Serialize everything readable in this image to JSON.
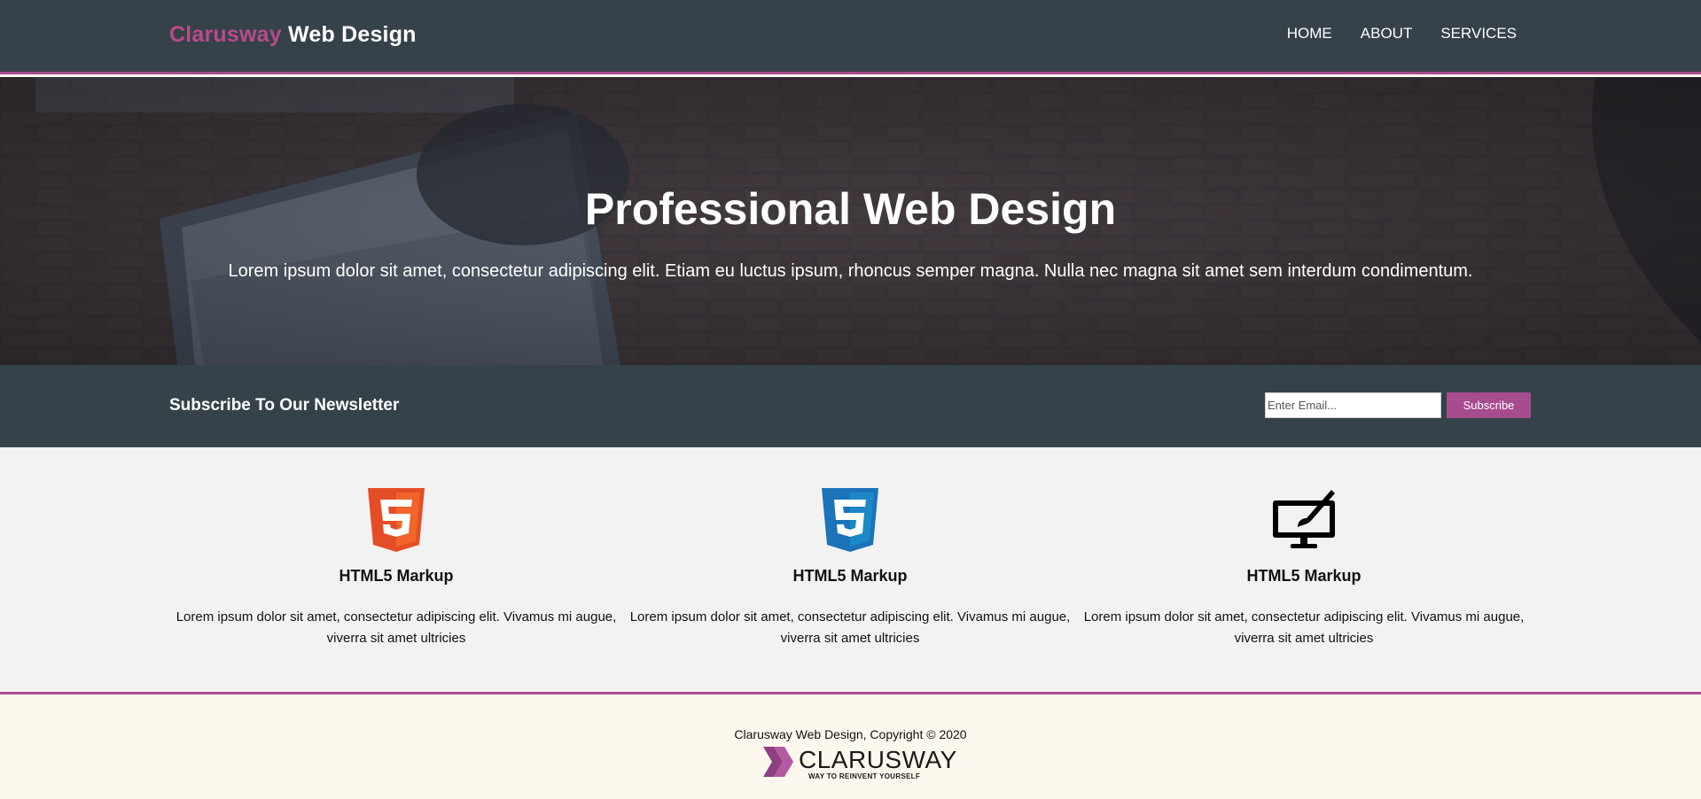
{
  "header": {
    "brand_highlight": "Clarusway",
    "brand_rest": " Web Design",
    "nav": [
      "HOME",
      "ABOUT",
      "SERVICES"
    ]
  },
  "hero": {
    "title": "Professional Web Design",
    "text": "Lorem ipsum dolor sit amet, consectetur adipiscing elit. Etiam eu luctus ipsum, rhoncus semper magna. Nulla nec magna sit amet sem interdum condimentum."
  },
  "newsletter": {
    "title": "Subscribe To Our Newsletter",
    "email_placeholder": "Enter Email...",
    "button_label": "Subscribe"
  },
  "boxes": [
    {
      "icon": "html5-icon",
      "title": "HTML5 Markup",
      "text": "Lorem ipsum dolor sit amet, consectetur adipiscing elit. Vivamus mi augue, viverra sit amet ultricies"
    },
    {
      "icon": "css3-icon",
      "title": "HTML5 Markup",
      "text": "Lorem ipsum dolor sit amet, consectetur adipiscing elit. Vivamus mi augue, viverra sit amet ultricies"
    },
    {
      "icon": "monitor-brush-icon",
      "title": "HTML5 Markup",
      "text": "Lorem ipsum dolor sit amet, consectetur adipiscing elit. Vivamus mi augue, viverra sit amet ultricies"
    }
  ],
  "footer": {
    "copyright": "Clarusway Web Design, Copyright © 2020",
    "logo_word": "CLARUSWAY",
    "logo_tagline": "WAY TO REINVENT YOURSELF"
  },
  "colors": {
    "dark": "#35424a",
    "accent": "#a74c8e",
    "brand_highlight": "#b94a89",
    "boxes_bg": "#f2f2f2",
    "footer_bg": "#fcf8ee"
  }
}
